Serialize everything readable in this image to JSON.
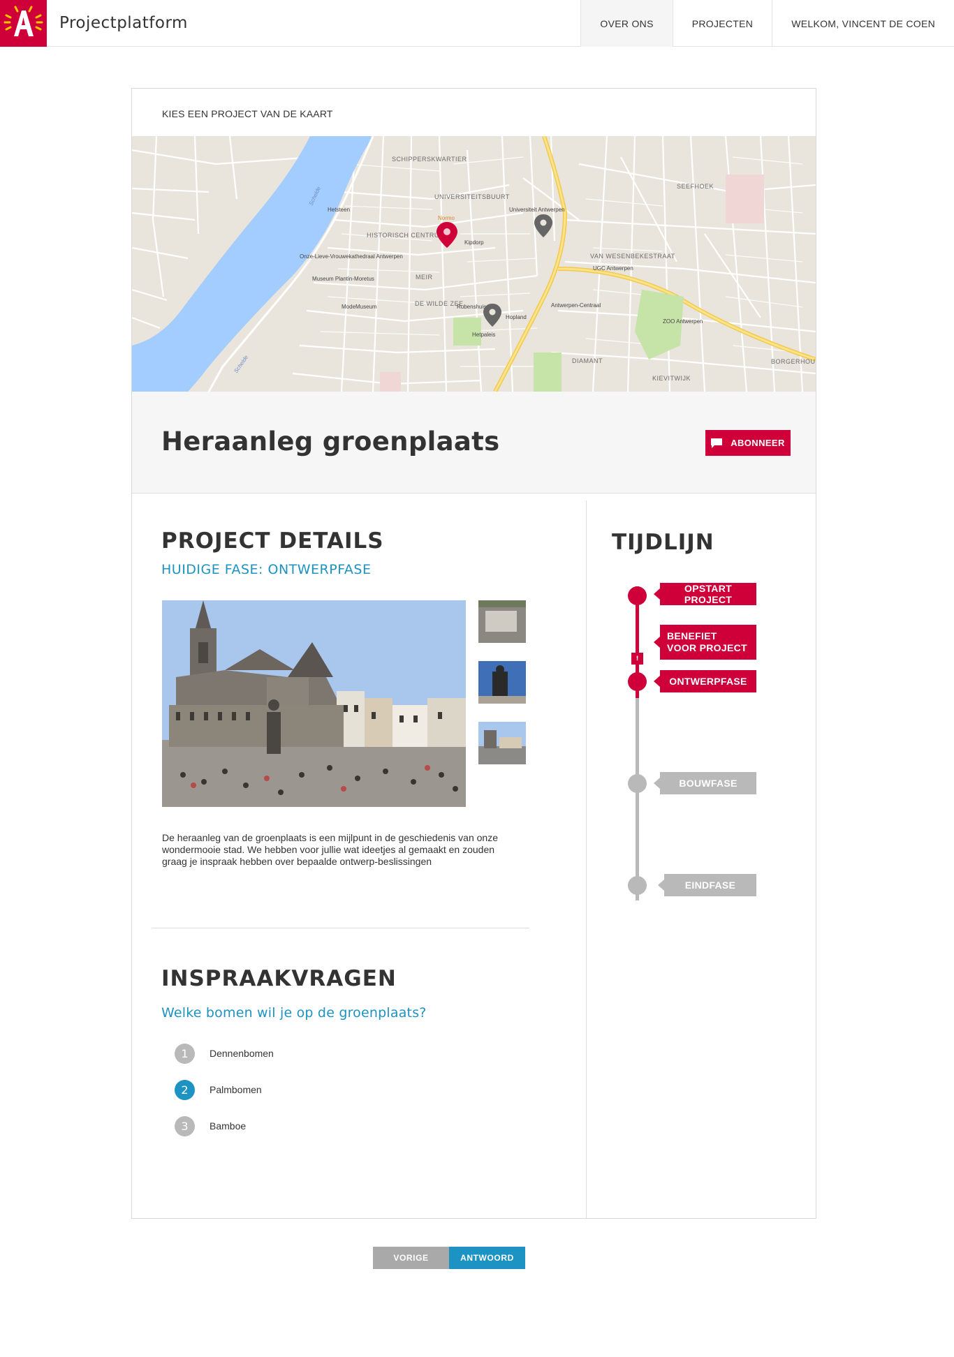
{
  "header": {
    "brand": "Projectplatform",
    "nav": [
      {
        "label": "OVER ONS",
        "active": true
      },
      {
        "label": "PROJECTEN",
        "active": false
      },
      {
        "label": "WELKOM, VINCENT DE COEN",
        "active": false
      }
    ]
  },
  "map": {
    "heading": "KIES EEN PROJECT VAN DE KAART",
    "labels": {
      "schippers": "SCHIPPERSKWARTIER",
      "univ": "UNIVERSITEITSBUURT",
      "centrum": "HISTORISCH CENTRUM",
      "meir": "MEIR",
      "wildezee": "DE WILDE ZEE",
      "wesenbeke": "VAN WESENBEKESTRAAT",
      "seefhoek": "SEEFHOEK",
      "diamant": "DIAMANT",
      "kievit": "KIEVITWIJK",
      "borgerhout": "BORGERHOUT",
      "kathedraal": "Onze-Lieve-Vrouwekathedraal Antwerpen",
      "plantin": "Museum Plantin-Moretus",
      "modemuseum": "ModeMuseum",
      "rubenshuis": "Rubenshuis",
      "centraal": "Antwerpen-Centraal",
      "zoo": "ZOO Antwerpen",
      "ugc": "UGC Antwerpen",
      "universiteit": "Universiteit Antwerpen",
      "hetsteen": "Hetsteen",
      "kipdorp": "Kipdorp",
      "schelde": "Schelde",
      "normo": "Normo",
      "hopland": "Hopland",
      "hetpaleis": "Hetpaleis"
    }
  },
  "project": {
    "title": "Heraanleg groenplaats",
    "subscribe_label": "ABONNEER",
    "details_title": "PROJECT DETAILS",
    "phase": "HUIDIGE FASE: ONTWERPFASE",
    "description": "De heraanleg van de groenplaats is een mijlpunt in de geschiedenis van onze wondermooie stad. We hebben voor jullie wat ideetjes al gemaakt en zouden graag je inspraak hebben over bepaalde ontwerp-beslissingen"
  },
  "inspraak": {
    "title": "INSPRAAKVRAGEN",
    "question": "Welke bomen wil je op de groenplaats?",
    "options": [
      {
        "num": "1",
        "label": "Dennenbomen",
        "selected": false
      },
      {
        "num": "2",
        "label": "Palmbomen",
        "selected": true
      },
      {
        "num": "3",
        "label": "Bamboe",
        "selected": false
      }
    ],
    "prev_label": "VORIGE",
    "answer_label": "ANTWOORD"
  },
  "timeline": {
    "title": "TIJDLIJN",
    "steps": [
      {
        "label": "OPSTART PROJECT",
        "done": true
      },
      {
        "label": "BENEFIET VOOR PROJECT",
        "done": true
      },
      {
        "label": "ONTWERPFASE",
        "done": true
      },
      {
        "label": "BOUWFASE",
        "done": false
      },
      {
        "label": "EINDFASE",
        "done": false
      }
    ]
  },
  "colors": {
    "brand_red": "#cf0039",
    "accent_blue": "#1c93c2",
    "inactive_grey": "#b9b9b9"
  }
}
